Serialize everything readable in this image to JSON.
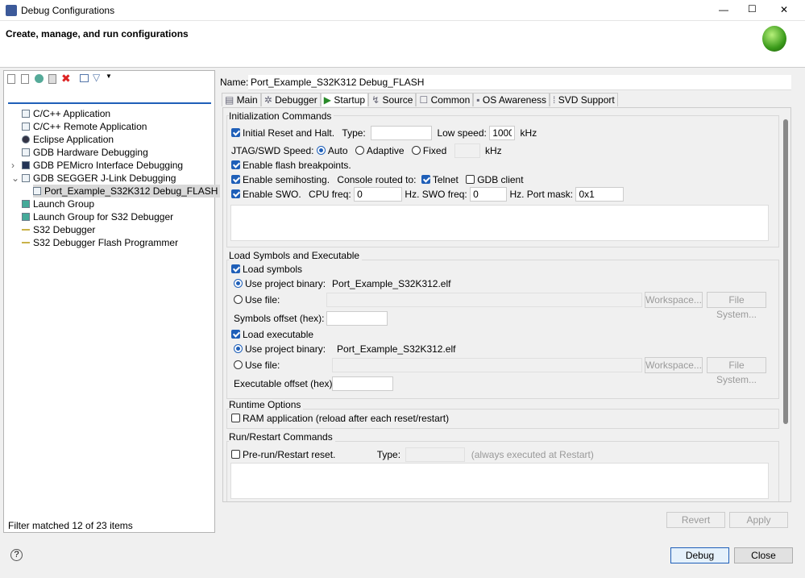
{
  "window": {
    "title": "Debug Configurations",
    "minimize": "—",
    "maximize": "☐",
    "close": "✕"
  },
  "banner": {
    "title": "Create, manage, and run configurations"
  },
  "left": {
    "filter_value": "",
    "tree": [
      {
        "label": "C/C++ Application",
        "icon": "c-app-icon"
      },
      {
        "label": "C/C++ Remote Application",
        "icon": "c-app-icon"
      },
      {
        "label": "Eclipse Application",
        "icon": "eclipse-icon"
      },
      {
        "label": "GDB Hardware Debugging",
        "icon": "c-app-icon"
      },
      {
        "label": "GDB PEMicro Interface Debugging",
        "icon": "pemicro-icon",
        "expander": "›"
      },
      {
        "label": "GDB SEGGER J-Link Debugging",
        "icon": "c-app-icon",
        "expander": "⌄"
      },
      {
        "label": "Port_Example_S32K312 Debug_FLASH",
        "icon": "c-app-icon",
        "selected": true
      },
      {
        "label": "Launch Group",
        "icon": "launch-group-icon"
      },
      {
        "label": "Launch Group for S32 Debugger",
        "icon": "launch-group-icon"
      },
      {
        "label": "S32 Debugger",
        "icon": "s32-icon"
      },
      {
        "label": "S32 Debugger Flash Programmer",
        "icon": "s32-icon"
      }
    ],
    "status": "Filter matched 12 of 23 items"
  },
  "config": {
    "name_label": "Name:",
    "name_value": "Port_Example_S32K312 Debug_FLASH",
    "tabs": [
      "Main",
      "Debugger",
      "Startup",
      "Source",
      "Common",
      "OS Awareness",
      "SVD Support"
    ],
    "active_tab": "Startup",
    "init": {
      "title": "Initialization Commands",
      "reset": "Initial Reset and Halt.",
      "type_label": "Type:",
      "type_value": "",
      "low_speed_label": "Low speed:",
      "low_speed_value": "1000",
      "khz": "kHz",
      "speed_label": "JTAG/SWD Speed:",
      "auto": "Auto",
      "adaptive": "Adaptive",
      "fixed": "Fixed",
      "fixed_value": "",
      "flash_bp": "Enable flash breakpoints.",
      "semihost": "Enable semihosting.",
      "console_label": "Console routed to:",
      "telnet": "Telnet",
      "gdb_client": "GDB client",
      "swo": "Enable SWO.",
      "cpu_freq_label": "CPU freq:",
      "cpu_freq": "0",
      "hz_swo": "Hz. SWO freq:",
      "swo_freq": "0",
      "hz_port": "Hz. Port mask:",
      "port_mask": "0x1"
    },
    "load": {
      "title": "Load Symbols and Executable",
      "load_symbols": "Load symbols",
      "use_project_binary": "Use project binary:",
      "binary": "Port_Example_S32K312.elf",
      "use_file": "Use file:",
      "workspace": "Workspace...",
      "file_system": "File System...",
      "sym_offset": "Symbols offset (hex):",
      "load_exec": "Load executable",
      "exec_offset": "Executable offset (hex):"
    },
    "runtime": {
      "title": "Runtime Options",
      "ram": "RAM application (reload after each reset/restart)"
    },
    "restart": {
      "title": "Run/Restart Commands",
      "prerun": "Pre-run/Restart reset.",
      "type_label": "Type:",
      "note": "(always executed at Restart)"
    },
    "revert": "Revert",
    "apply": "Apply"
  },
  "footer": {
    "help": "?",
    "debug": "Debug",
    "close": "Close"
  }
}
